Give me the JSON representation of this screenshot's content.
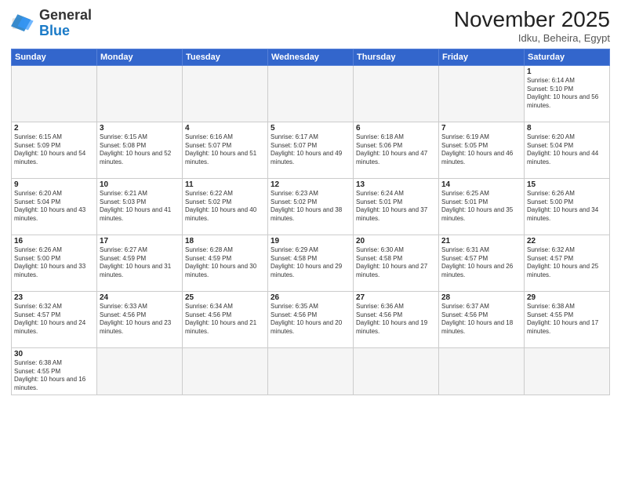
{
  "header": {
    "logo_general": "General",
    "logo_blue": "Blue",
    "month_year": "November 2025",
    "location": "Idku, Beheira, Egypt"
  },
  "weekdays": [
    "Sunday",
    "Monday",
    "Tuesday",
    "Wednesday",
    "Thursday",
    "Friday",
    "Saturday"
  ],
  "weeks": [
    [
      {
        "day": "",
        "info": ""
      },
      {
        "day": "",
        "info": ""
      },
      {
        "day": "",
        "info": ""
      },
      {
        "day": "",
        "info": ""
      },
      {
        "day": "",
        "info": ""
      },
      {
        "day": "",
        "info": ""
      },
      {
        "day": "1",
        "info": "Sunrise: 6:14 AM\nSunset: 5:10 PM\nDaylight: 10 hours and 56 minutes."
      }
    ],
    [
      {
        "day": "2",
        "info": "Sunrise: 6:15 AM\nSunset: 5:09 PM\nDaylight: 10 hours and 54 minutes."
      },
      {
        "day": "3",
        "info": "Sunrise: 6:15 AM\nSunset: 5:08 PM\nDaylight: 10 hours and 52 minutes."
      },
      {
        "day": "4",
        "info": "Sunrise: 6:16 AM\nSunset: 5:07 PM\nDaylight: 10 hours and 51 minutes."
      },
      {
        "day": "5",
        "info": "Sunrise: 6:17 AM\nSunset: 5:07 PM\nDaylight: 10 hours and 49 minutes."
      },
      {
        "day": "6",
        "info": "Sunrise: 6:18 AM\nSunset: 5:06 PM\nDaylight: 10 hours and 47 minutes."
      },
      {
        "day": "7",
        "info": "Sunrise: 6:19 AM\nSunset: 5:05 PM\nDaylight: 10 hours and 46 minutes."
      },
      {
        "day": "8",
        "info": "Sunrise: 6:20 AM\nSunset: 5:04 PM\nDaylight: 10 hours and 44 minutes."
      }
    ],
    [
      {
        "day": "9",
        "info": "Sunrise: 6:20 AM\nSunset: 5:04 PM\nDaylight: 10 hours and 43 minutes."
      },
      {
        "day": "10",
        "info": "Sunrise: 6:21 AM\nSunset: 5:03 PM\nDaylight: 10 hours and 41 minutes."
      },
      {
        "day": "11",
        "info": "Sunrise: 6:22 AM\nSunset: 5:02 PM\nDaylight: 10 hours and 40 minutes."
      },
      {
        "day": "12",
        "info": "Sunrise: 6:23 AM\nSunset: 5:02 PM\nDaylight: 10 hours and 38 minutes."
      },
      {
        "day": "13",
        "info": "Sunrise: 6:24 AM\nSunset: 5:01 PM\nDaylight: 10 hours and 37 minutes."
      },
      {
        "day": "14",
        "info": "Sunrise: 6:25 AM\nSunset: 5:01 PM\nDaylight: 10 hours and 35 minutes."
      },
      {
        "day": "15",
        "info": "Sunrise: 6:26 AM\nSunset: 5:00 PM\nDaylight: 10 hours and 34 minutes."
      }
    ],
    [
      {
        "day": "16",
        "info": "Sunrise: 6:26 AM\nSunset: 5:00 PM\nDaylight: 10 hours and 33 minutes."
      },
      {
        "day": "17",
        "info": "Sunrise: 6:27 AM\nSunset: 4:59 PM\nDaylight: 10 hours and 31 minutes."
      },
      {
        "day": "18",
        "info": "Sunrise: 6:28 AM\nSunset: 4:59 PM\nDaylight: 10 hours and 30 minutes."
      },
      {
        "day": "19",
        "info": "Sunrise: 6:29 AM\nSunset: 4:58 PM\nDaylight: 10 hours and 29 minutes."
      },
      {
        "day": "20",
        "info": "Sunrise: 6:30 AM\nSunset: 4:58 PM\nDaylight: 10 hours and 27 minutes."
      },
      {
        "day": "21",
        "info": "Sunrise: 6:31 AM\nSunset: 4:57 PM\nDaylight: 10 hours and 26 minutes."
      },
      {
        "day": "22",
        "info": "Sunrise: 6:32 AM\nSunset: 4:57 PM\nDaylight: 10 hours and 25 minutes."
      }
    ],
    [
      {
        "day": "23",
        "info": "Sunrise: 6:32 AM\nSunset: 4:57 PM\nDaylight: 10 hours and 24 minutes."
      },
      {
        "day": "24",
        "info": "Sunrise: 6:33 AM\nSunset: 4:56 PM\nDaylight: 10 hours and 23 minutes."
      },
      {
        "day": "25",
        "info": "Sunrise: 6:34 AM\nSunset: 4:56 PM\nDaylight: 10 hours and 21 minutes."
      },
      {
        "day": "26",
        "info": "Sunrise: 6:35 AM\nSunset: 4:56 PM\nDaylight: 10 hours and 20 minutes."
      },
      {
        "day": "27",
        "info": "Sunrise: 6:36 AM\nSunset: 4:56 PM\nDaylight: 10 hours and 19 minutes."
      },
      {
        "day": "28",
        "info": "Sunrise: 6:37 AM\nSunset: 4:56 PM\nDaylight: 10 hours and 18 minutes."
      },
      {
        "day": "29",
        "info": "Sunrise: 6:38 AM\nSunset: 4:55 PM\nDaylight: 10 hours and 17 minutes."
      }
    ],
    [
      {
        "day": "30",
        "info": "Sunrise: 6:38 AM\nSunset: 4:55 PM\nDaylight: 10 hours and 16 minutes."
      },
      {
        "day": "",
        "info": ""
      },
      {
        "day": "",
        "info": ""
      },
      {
        "day": "",
        "info": ""
      },
      {
        "day": "",
        "info": ""
      },
      {
        "day": "",
        "info": ""
      },
      {
        "day": "",
        "info": ""
      }
    ]
  ]
}
